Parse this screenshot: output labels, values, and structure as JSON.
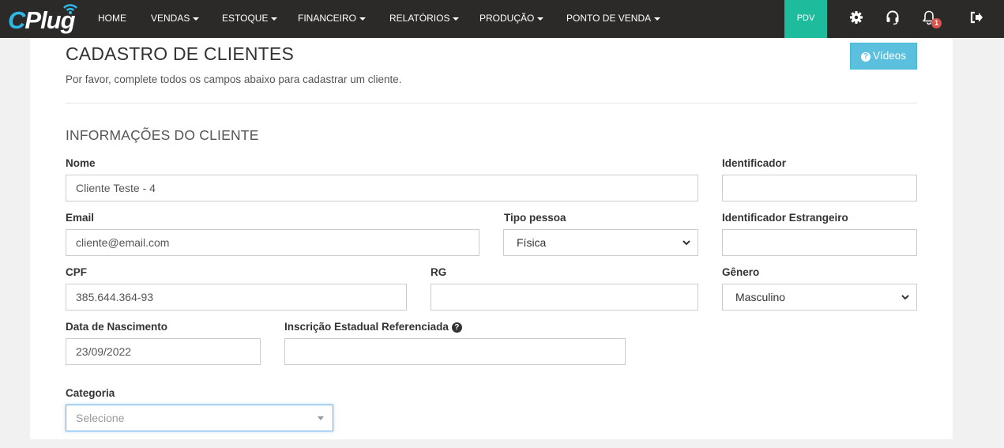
{
  "brand": {
    "logo_text_c": "C",
    "logo_text_rest": "Plug"
  },
  "nav": {
    "items": [
      {
        "label": "HOME",
        "dropdown": false
      },
      {
        "label": "VENDAS",
        "dropdown": true
      },
      {
        "label": "ESTOQUE",
        "dropdown": true
      },
      {
        "label": "FINANCEIRO",
        "dropdown": true
      },
      {
        "label": "RELATÓRIOS",
        "dropdown": true
      },
      {
        "label": "PRODUÇÃO",
        "dropdown": true
      },
      {
        "label": "PONTO DE VENDA",
        "dropdown": true
      }
    ],
    "pdv_label": "PDV",
    "icons": [
      "gear-icon",
      "headset-icon",
      "bell-icon",
      "logout-icon"
    ],
    "notification_count": "1"
  },
  "page": {
    "title": "CADASTRO DE CLIENTES",
    "subtitle": "Por favor, complete todos os campos abaixo para cadastrar um cliente.",
    "videos_button": "Vídeos",
    "section_title": "INFORMAÇÕES DO CLIENTE"
  },
  "form": {
    "nome": {
      "label": "Nome",
      "value": "Cliente Teste - 4"
    },
    "identificador": {
      "label": "Identificador",
      "value": ""
    },
    "email": {
      "label": "Email",
      "value": "cliente@email.com"
    },
    "tipo_pessoa": {
      "label": "Tipo pessoa",
      "value": "Física"
    },
    "identificador_estrangeiro": {
      "label": "Identificador Estrangeiro",
      "value": ""
    },
    "cpf": {
      "label": "CPF",
      "value": "385.644.364-93"
    },
    "rg": {
      "label": "RG",
      "value": ""
    },
    "genero": {
      "label": "Gênero",
      "value": "Masculino"
    },
    "data_nascimento": {
      "label": "Data de Nascimento",
      "value": "23/09/2022"
    },
    "inscricao_estadual": {
      "label": "Inscrição Estadual Referenciada",
      "value": ""
    },
    "categoria": {
      "label": "Categoria",
      "placeholder": "Selecione"
    }
  },
  "colors": {
    "navbar": "#2b2a29",
    "pdv": "#1dbc9c",
    "info_button": "#5bc0de",
    "logo_accent": "#2eb8e6",
    "badge": "#d9534f"
  }
}
